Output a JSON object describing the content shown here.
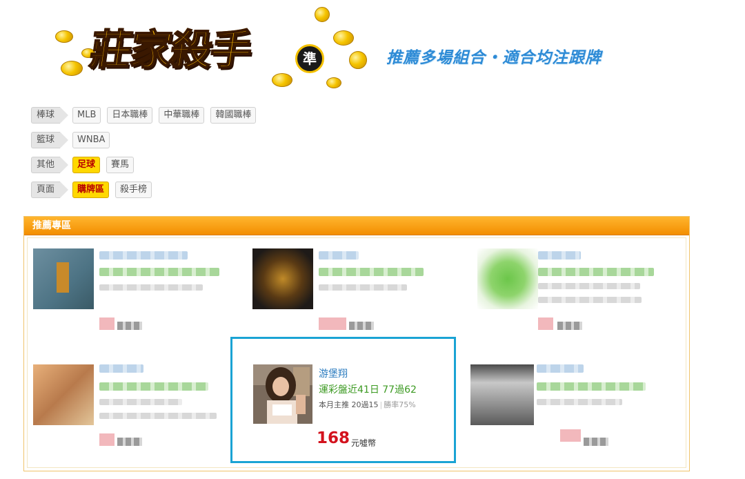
{
  "banner": {
    "logo_text": "莊家殺手",
    "logo_seal": "準",
    "slogan": "推薦多場組合・適合均注跟牌"
  },
  "categories": [
    {
      "label": "棒球",
      "tags": [
        {
          "text": "MLB",
          "active": false
        },
        {
          "text": "日本職棒",
          "active": false
        },
        {
          "text": "中華職棒",
          "active": false
        },
        {
          "text": "韓國職棒",
          "active": false
        }
      ]
    },
    {
      "label": "籃球",
      "tags": [
        {
          "text": "WNBA",
          "active": false
        }
      ]
    },
    {
      "label": "其他",
      "tags": [
        {
          "text": "足球",
          "active": true
        },
        {
          "text": "賽馬",
          "active": false
        }
      ]
    },
    {
      "label": "頁面",
      "tags": [
        {
          "text": "購牌區",
          "active": true
        },
        {
          "text": "殺手榜",
          "active": false
        }
      ]
    }
  ],
  "panel": {
    "title": "推薦專區"
  },
  "featured": {
    "name": "游堡翔",
    "record": "運彩盤近41日 77過62",
    "month_pick": "本月主推 20過15",
    "win_rate": "勝率75%",
    "price": "168",
    "unit": "元噓幣"
  },
  "colors": {
    "accent_orange": "#f39800",
    "highlight_border": "#1aa3d4",
    "price_red": "#d3121d",
    "active_tag": "#ffd800"
  }
}
